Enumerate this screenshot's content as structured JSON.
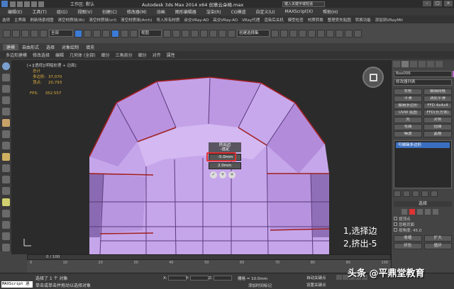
{
  "titlebar": {
    "workspace_label": "工作区: 默认",
    "title": "Autodesk 3ds Max  2014 x64       创意云朵椅.max",
    "search_placeholder": "键入关键字或短语"
  },
  "menu": {
    "items": [
      "编辑(E)",
      "工具(T)",
      "组(G)",
      "视图(V)",
      "创建(C)",
      "修改器(M)",
      "动画",
      "图形编辑器",
      "渲染(R)",
      "CG模道",
      "自定义(U)",
      "MAXScript(X)",
      "帮助(H)"
    ]
  },
  "scriptbar": {
    "items": [
      "选项",
      "主界面",
      "刷新场景视图",
      "清空材质球(Rt)",
      "清空材质球(vrl)",
      "清空材质球(Arch)",
      "导入所有材质",
      "余交VRay-AO",
      "高交VRay-AO",
      "VRay代理",
      "渲染后关机",
      "模型检查",
      "材质转换",
      "整理丢失贴图",
      "转换功能",
      "添加到VRayMtl"
    ]
  },
  "toolbar": {
    "selection_filter": "全部",
    "view_dropdown": "视图",
    "named_selection": "创建选择集"
  },
  "ribbon": {
    "tabs": [
      "建模",
      "自由形式",
      "选择",
      "对象绘制",
      "填充"
    ],
    "sub_items": [
      "多边形建模",
      "修改选择",
      "编辑",
      "几何体 (全部)",
      "细分",
      "三角剖分",
      "细分",
      "对齐",
      "属性"
    ]
  },
  "viewport": {
    "label": "[+][透视][明暗处理 + 边面]",
    "stats": [
      {
        "label": "总计",
        "value": ""
      },
      {
        "label": "多边形:",
        "value": "37,070"
      },
      {
        "label": "顶点:",
        "value": "20,793"
      }
    ],
    "fps_label": "FPS:",
    "fps_value": "352.557",
    "caddy_title": "挤出边",
    "caddy_subtitle": "-选定",
    "caddy_height": "-5.0mm",
    "caddy_width": "2.0mm",
    "caddy_buttons": [
      "✓",
      "+",
      "×"
    ],
    "mesh_colors": {
      "light": "#c9a8ec",
      "mid": "#b48fdd",
      "dark": "#8a6bb3",
      "edge_selected": "#a02020"
    }
  },
  "annotations": {
    "step1": "1,选择边",
    "step2": "2,挤出-5"
  },
  "rightpanel": {
    "object_name": "Box006",
    "modifier_list": "修改器列表",
    "buttons": [
      "车削",
      "编辑网格",
      "平滑",
      "涡轮平滑",
      "编辑多边形",
      "FFD 4x4x4",
      "UVW 贴图",
      "切片",
      "壳",
      "对称",
      "弯曲",
      "扭曲",
      "噪波",
      "晶格"
    ],
    "ffd_label": "FFD(长方体)",
    "stack_item": "可编辑多边形",
    "selection_title": "选择",
    "opts": [
      "按顶点",
      "忽略背面",
      "按角度:"
    ],
    "angle_value": "45.0",
    "shrink": "收缩",
    "grow": "扩大",
    "ring": "环形",
    "loop": "循环"
  },
  "timeline": {
    "frame": "0 / 100",
    "ticks": [
      "0",
      "10",
      "20",
      "30",
      "40",
      "50",
      "60",
      "70",
      "80",
      "90",
      "100"
    ]
  },
  "status": {
    "maxscript": "MAXScript 迷",
    "line1": "选择了 1 个 对象",
    "line2": "单击或单击并拖动以选择对象",
    "x_label": "X:",
    "y_label": "Y:",
    "z_label": "Z:",
    "grid": "栅格 = 10.0mm",
    "add_time_tag": "添加时间标记",
    "autokey": "自动关键点",
    "setkey": "设置关键点"
  },
  "watermark": "头条 @平鼎堂教育"
}
